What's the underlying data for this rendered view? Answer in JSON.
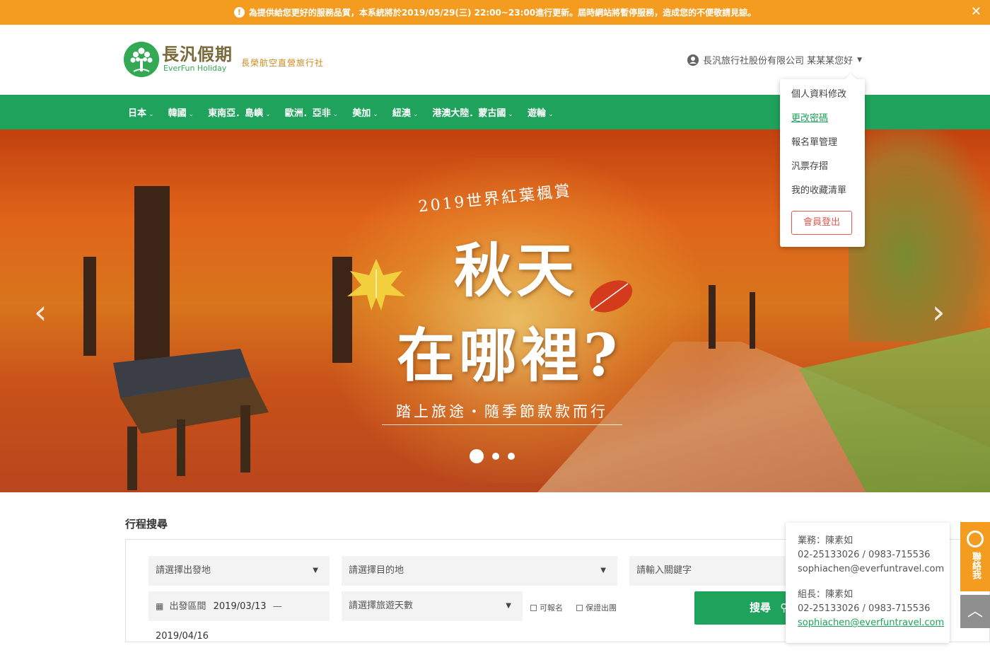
{
  "notice": {
    "text": "為提供給您更好的服務品質，本系統將於2019/05/29(三) 22:00~23:00進行更新。屆時網站將暫停服務，造成您的不便敬請見諒。",
    "close_label": "✕"
  },
  "brand": {
    "name_cn": "長汎假期",
    "name_en": "EverFun Holiday",
    "tagline": "長榮航空直營旅行社"
  },
  "user": {
    "greeting": "長汎旅行社股份有限公司 某某某您好"
  },
  "user_menu": {
    "items": [
      "個人資料修改",
      "更改密碼",
      "報名單管理",
      "汎票存摺",
      "我的收藏清單"
    ],
    "active_index": 1,
    "logout_label": "會員登出"
  },
  "nav": {
    "items": [
      "日本",
      "韓國",
      "東南亞．島嶼",
      "歐洲．亞非",
      "美加",
      "紐澳",
      "港澳大陸．蒙古國",
      "遊輪"
    ]
  },
  "hero": {
    "headline_top": "2019世界紅葉楓賞",
    "headline_line1": "秋天",
    "headline_line2": "在哪裡?",
    "subline": "踏上旅途‧隨季節款款而行",
    "prev_label": "‹",
    "next_label": "›",
    "slide_count": 3,
    "active_slide": 0
  },
  "search": {
    "title": "行程搜尋",
    "departure_placeholder": "請選擇出發地",
    "destination_placeholder": "請選擇目的地",
    "keyword_placeholder": "請輸入關鍵字",
    "date_label": "出發區間",
    "date_from": "2019/03/13",
    "date_sep": "—",
    "date_to": "2019/04/16",
    "days_placeholder": "請選擇旅遊天數",
    "check_available": "可報名",
    "check_guaranteed": "保證出團",
    "button_label": "搜尋"
  },
  "contact": {
    "sales_label": "業務：陳素如",
    "sales_phone": "02-25133026 / 0983-715536",
    "sales_email": "sophiachen@everfuntravel.com",
    "leader_label": "組長：陳素如",
    "leader_phone": "02-25133026 / 0983-715536",
    "leader_email": "sophiachen@everfuntravel.com"
  },
  "side": {
    "contact_label": "聯絡我",
    "top_label": "︿"
  },
  "colors": {
    "brand_green": "#1fa25b",
    "notice_orange": "#f39c1f",
    "logout_red": "#e05a4f"
  }
}
